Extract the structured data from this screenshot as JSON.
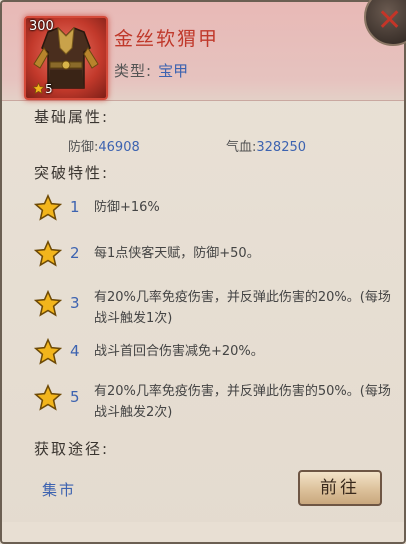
{
  "item": {
    "name": "金丝软猬甲",
    "count": "300",
    "star_level": "5",
    "type_label": "类型:",
    "type_value": "宝甲"
  },
  "base_attributes": {
    "title": "基础属性:",
    "defense_label": "防御:",
    "defense_value": "46908",
    "hp_label": "气血:",
    "hp_value": "328250"
  },
  "breakthrough": {
    "title": "突破特性:",
    "traits": [
      {
        "num": "1",
        "text": "防御+16%"
      },
      {
        "num": "2",
        "text": "每1点侠客天赋，防御+50。"
      },
      {
        "num": "3",
        "text": "有20%几率免疫伤害，并反弹此伤害的20%。(每场战斗触发1次)"
      },
      {
        "num": "4",
        "text": "战斗首回合伤害减免+20%。"
      },
      {
        "num": "5",
        "text": "有20%几率免疫伤害，并反弹此伤害的50%。(每场战斗触发2次)"
      }
    ]
  },
  "acquire": {
    "title": "获取途径:",
    "source": "集市",
    "goto_label": "前往"
  },
  "colors": {
    "name": "#c0392b",
    "value_blue": "#3d63b0",
    "star_gold": "#f2b51c"
  },
  "icons": {
    "item": "armor-vest-icon",
    "close": "close-icon",
    "trait": "star-icon"
  }
}
